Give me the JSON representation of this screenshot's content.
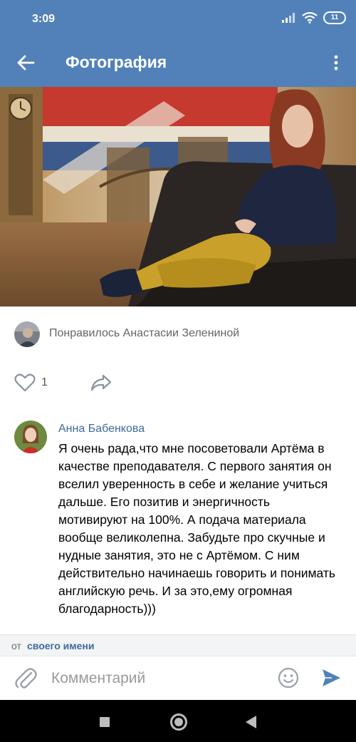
{
  "status_bar": {
    "time": "3:09",
    "battery": "11"
  },
  "header": {
    "title": "Фотография",
    "back_icon": "arrow-left-icon",
    "more_icon": "more-vertical-icon"
  },
  "liked": {
    "text": "Понравилось Анастасии Зелениной"
  },
  "actions": {
    "like_count": "1",
    "like_icon": "heart-outline-icon",
    "share_icon": "share-arrow-icon"
  },
  "comment": {
    "author": "Анна Бабенкова",
    "text": "Я очень рада,что мне посоветовали Артёма в качестве преподавателя. С первого занятия он вселил уверенность в себе и желание учиться дальше. Его позитив и энергичность мотивируют на 100%. А подача материала вообще великолепна. Забудьте про скучные и нудные занятия, это не с Артёмом. С ним действительно начинаешь говорить и понимать английскую речь. И за это,ему огромная благодарность)))"
  },
  "composer": {
    "from_prefix": "от",
    "from_link": "своего имени",
    "placeholder": "Комментарий",
    "attach_icon": "paperclip-icon",
    "emoji_icon": "smiley-icon",
    "send_icon": "send-icon"
  },
  "colors": {
    "header_bg": "#5181b8",
    "link": "#3e6a9a",
    "accent": "#5181b8"
  }
}
